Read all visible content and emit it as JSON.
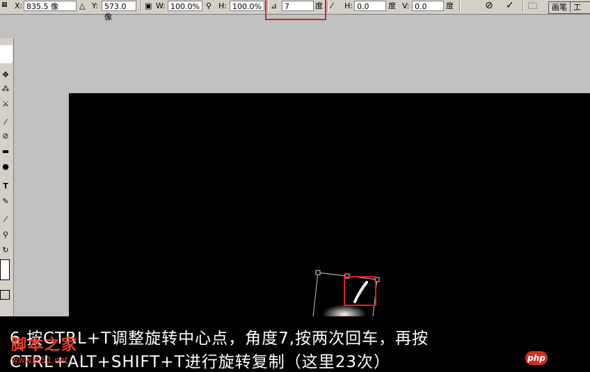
{
  "options_bar": {
    "x_label": "X:",
    "x_value": "835.5 像",
    "y_label": "Y:",
    "y_value": "573.0 像",
    "w_label": "W:",
    "w_value": "100.0%",
    "h_label": "H:",
    "h_value": "100.0%",
    "angle_value": "7",
    "angle_unit": "度",
    "skew_h_label": "H:",
    "skew_h_value": "0.0",
    "skew_h_unit": "度",
    "skew_v_label": "V:",
    "skew_v_value": "0.0",
    "skew_v_unit": "度",
    "palette_tab_1": "画笔",
    "palette_tab_2": "工"
  },
  "caption": {
    "line1": "6 按CTRL+T调整旋转中心点，角度7,按两次回车，再按",
    "line2": "CTRL+ALT+SHIFT+T进行旋转复制（这里23次）"
  },
  "watermark": {
    "site_cn": "脚本之家",
    "site_url": "www.jb51.net",
    "badge": "php"
  },
  "colors": {
    "annotation_red": "#e02020",
    "canvas": "#000000",
    "workspace": "#c0c0c0"
  }
}
